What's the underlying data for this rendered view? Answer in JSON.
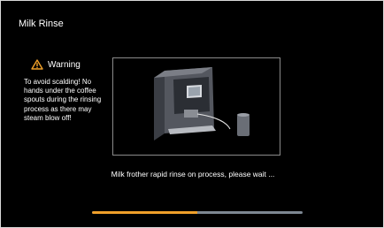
{
  "screen": {
    "title": "Milk Rinse",
    "warning": {
      "icon": "warning-triangle-icon",
      "label": "Warning",
      "text": "To avoid scalding! No hands under the coffee spouts during the rinsing process as there may steam blow off!"
    },
    "illustration": {
      "icon": "coffee-machine-with-milk-container"
    },
    "status_text": "Milk frother rapid rinse on process, please wait ...",
    "progress": {
      "percent": 50
    },
    "colors": {
      "background": "#000000",
      "accent": "#f0a02a",
      "track": "#7d8792",
      "warning": "#f0a02a"
    }
  }
}
